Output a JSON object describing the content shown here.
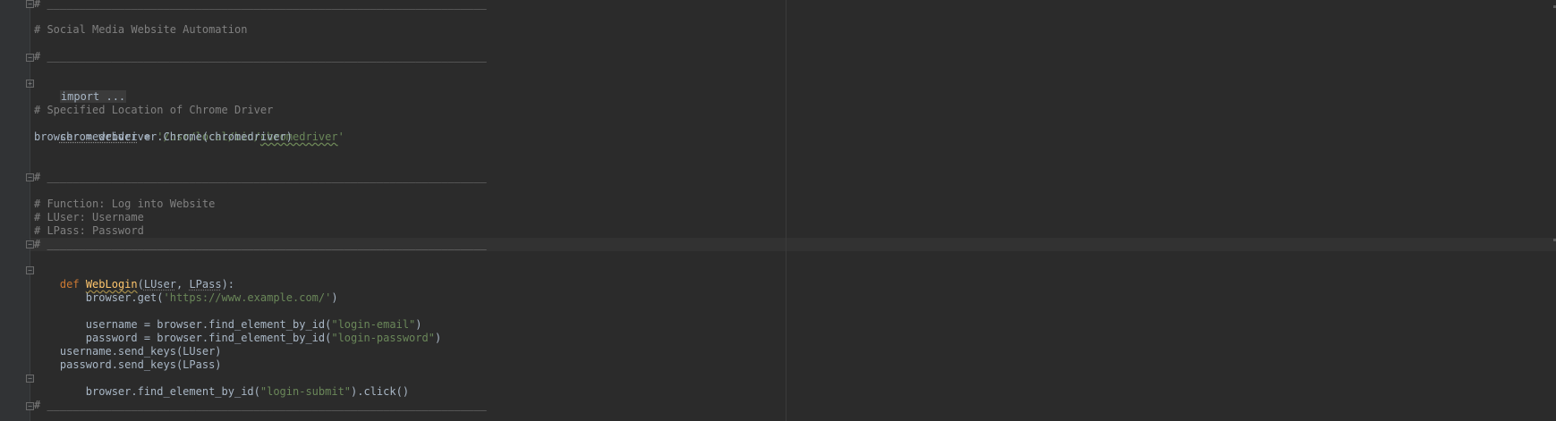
{
  "editor": {
    "colors": {
      "background": "#2b2b2b",
      "gutter": "#313335",
      "comment": "#808080",
      "keyword": "#cc7832",
      "string": "#6a8759",
      "function": "#ffc66d",
      "text": "#a9b7c6"
    },
    "lines": {
      "rule_top": "# ____________________________________________________________________",
      "title_comment": "# Social Media Website Automation",
      "rule_2": "# ____________________________________________________________________",
      "import_folded": "import ...",
      "driver_comment": "# Specified Location of Chrome Driver",
      "chromedriver_var": "chromedriver",
      "chromedriver_assign": " = ",
      "chromedriver_path_a": "'/usr/local/bin/",
      "chromedriver_path_b": "chromedriver",
      "chromedriver_path_c": "'",
      "browser_line": "browser = webdriver.Chrome(chromedriver)",
      "rule_3": "# ____________________________________________________________________",
      "fn_comment_1": "# Function: Log into Website",
      "fn_comment_2": "# LUser: Username",
      "fn_comment_3": "# LPass: Password",
      "rule_4": "# ____________________________________________________________________",
      "def_kw": "def",
      "def_space": " ",
      "def_name": "WebLogin",
      "def_open": "(",
      "def_param1": "LUser",
      "def_comma": ", ",
      "def_param2": "LPass",
      "def_close": "):",
      "get_prefix": "    browser.get(",
      "get_url": "'https://www.example.com/'",
      "get_suffix": ")",
      "username_prefix": "    username = browser.find_element_by_id(",
      "username_arg": "\"login-email\"",
      "username_suffix": ")",
      "password_prefix": "    password = browser.find_element_by_id(",
      "password_arg": "\"login-password\"",
      "password_suffix": ")",
      "send_user": "    username.send_keys(LUser)",
      "send_pass": "    password.send_keys(LPass)",
      "submit_prefix": "    browser.find_element_by_id(",
      "submit_arg": "\"login-submit\"",
      "submit_suffix": ").click()",
      "rule_bottom": "# ____________________________________________________________________"
    },
    "fold_marker": "−",
    "fold_marker_plus": "+"
  }
}
